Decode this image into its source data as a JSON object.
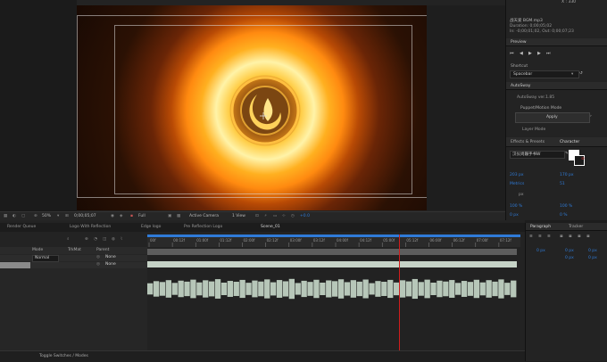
{
  "viewer": {
    "zoom": "50%",
    "timecode": "0;00;05;07",
    "resolution": "Full",
    "camera": "Active Camera",
    "view": "1 View",
    "exposure": "+0.0"
  },
  "info_panel": {
    "x_readout": "X : 330",
    "file": "战天爱 BGM.mp3",
    "duration": "Duration: 0;00;05;02",
    "inout": "In: -0;00;01;02, Out: 0;00;07;23"
  },
  "preview_panel": {
    "title": "Preview",
    "shortcut_label": "Shortcut",
    "shortcut_value": "Spacebar"
  },
  "autosway": {
    "title": "AutoSway",
    "version": "AutoSway ver.1.85",
    "mode": "Puppet/Motion Mode",
    "apply": "Apply",
    "layer_mode": "Layer Mode"
  },
  "character": {
    "tab_effects": "Effects & Presets",
    "tab_character": "Character",
    "font": "汉仪尚巍手书W",
    "size": "203 px",
    "leading": "170 px",
    "tracking": "Metrics",
    "kerning": "51",
    "stroke": "px",
    "vscale": "100 %",
    "hscale": "100 %",
    "baseline": "0 px",
    "tsume": "0 %"
  },
  "timeline_tabs": [
    "Render Queue",
    "Logo With Reflection",
    "Edge logo",
    "Pre Reflection Logo",
    "Scene_01"
  ],
  "layer_columns": {
    "mode": "Mode",
    "trkmat": "TrkMat",
    "parent": "Parent"
  },
  "layers": [
    {
      "mode": "Normal",
      "parent": "None"
    },
    {
      "mode": "",
      "parent": "None"
    }
  ],
  "ruler_ticks": [
    "00f",
    "00:12f",
    "01:00f",
    "01:12f",
    "02:00f",
    "02:12f",
    "03:00f",
    "03:12f",
    "04:00f",
    "04:12f",
    "05:00f",
    "05:12f",
    "06:00f",
    "06:12f",
    "07:00f",
    "07:12f"
  ],
  "paragraph": {
    "tab_paragraph": "Paragraph",
    "tab_tracker": "Tracker",
    "indent_left": "0 px",
    "indent_right": "0 px",
    "indent_first": "0 px",
    "space_before": "0 px",
    "space_after": "0 px"
  },
  "bottom": {
    "toggle": "Toggle Switches / Modes"
  },
  "colors": {
    "accent": "#2f7bd8",
    "playhead": "#d11c1c",
    "audio": "#b7c7b9",
    "track": "#c5d2c6"
  },
  "waveform": [
    0.45,
    0.62,
    0.55,
    0.7,
    0.48,
    0.66,
    0.58,
    0.74,
    0.52,
    0.69,
    0.6,
    0.78,
    0.5,
    0.64,
    0.57,
    0.72,
    0.49,
    0.67,
    0.59,
    0.76,
    0.53,
    0.71,
    0.61,
    0.8,
    0.47,
    0.65,
    0.56,
    0.73,
    0.5,
    0.68,
    0.62,
    0.77,
    0.54,
    0.7,
    0.58,
    0.75,
    0.46,
    0.63,
    0.57,
    0.72,
    0.51,
    0.69,
    0.6,
    0.79,
    0.55,
    0.74,
    0.5,
    0.66,
    0.59,
    0.71,
    0.48,
    0.64,
    0.56,
    0.73,
    0.52,
    0.7,
    0.58,
    0.76,
    0.49,
    0.67
  ],
  "playhead_time": "05:00f"
}
